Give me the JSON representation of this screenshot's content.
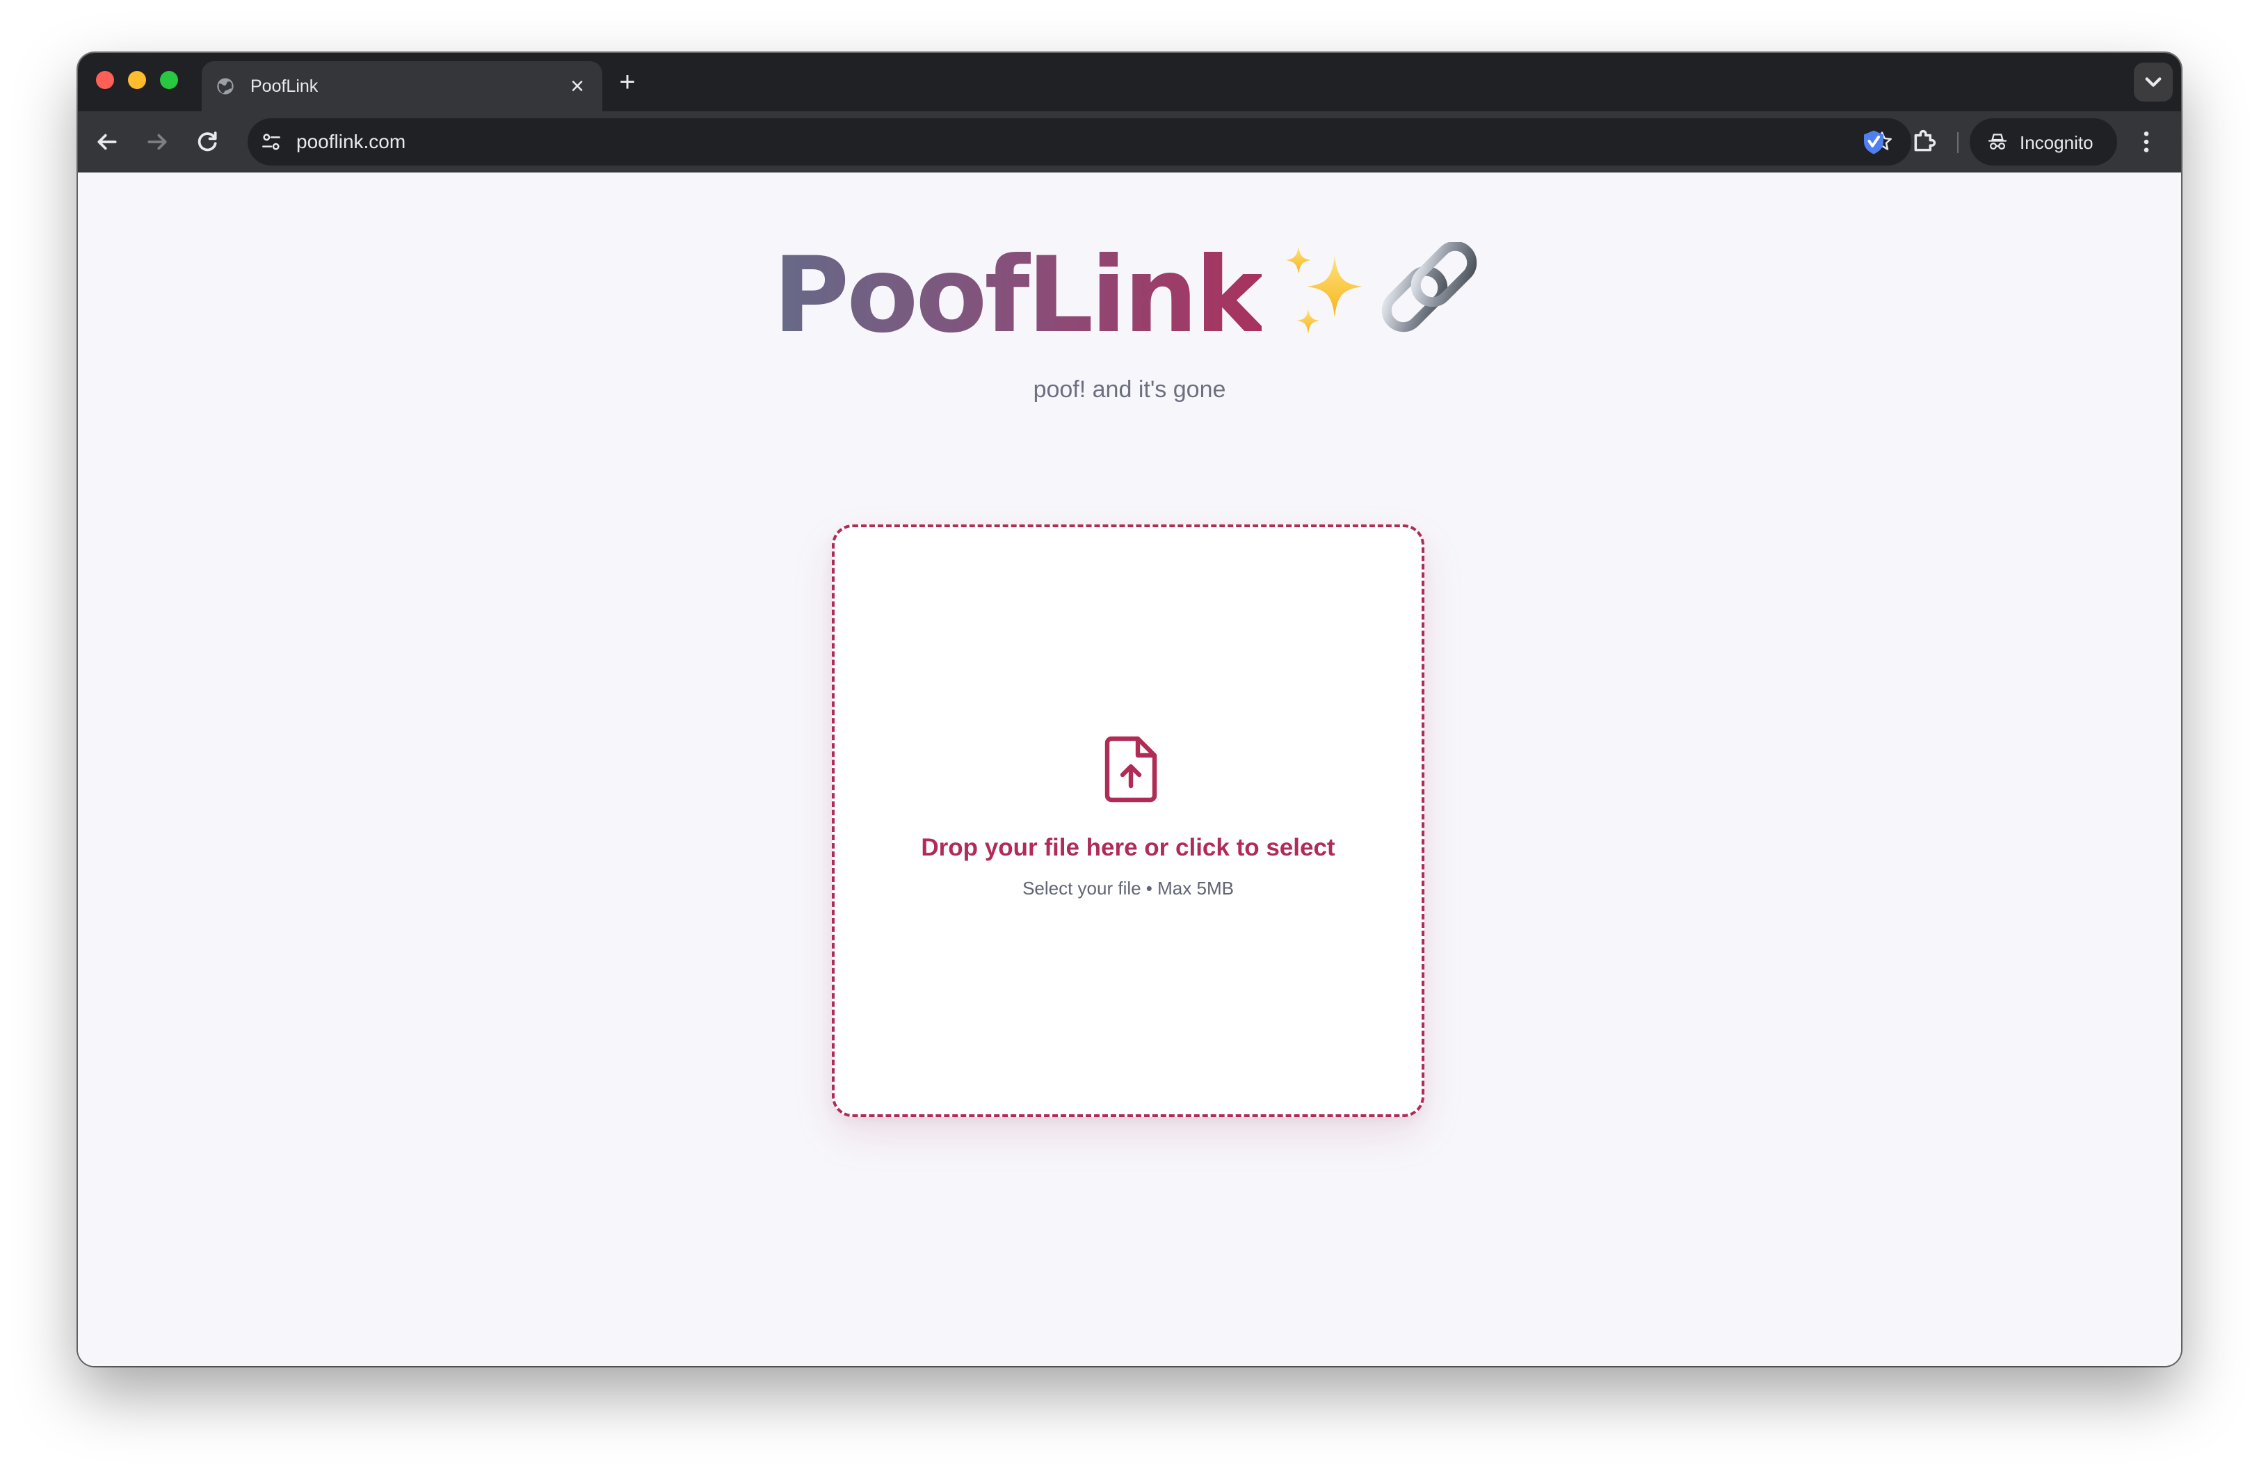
{
  "browser": {
    "tab": {
      "title": "PoofLink",
      "close_glyph": "×",
      "favicon": "globe-icon"
    },
    "new_tab_glyph": "+",
    "address_bar": {
      "url": "pooflink.com"
    },
    "profile_label": "Incognito",
    "icons": [
      "back-arrow-icon",
      "forward-arrow-icon",
      "reload-icon",
      "site-settings-icon",
      "star-icon",
      "extension-icon",
      "puzzle-icon",
      "incognito-icon",
      "kebab-menu-icon",
      "tab-search-icon"
    ]
  },
  "app": {
    "title": "PoofLink",
    "title_emoji": "sparkles-link-icon",
    "tagline": "poof! and it's gone"
  },
  "dropzone": {
    "title": "Drop your file here or click to select",
    "subtitle": "Select your file • Max 5MB",
    "icon": "file-upload-icon"
  },
  "colors": {
    "accent": "#b02b56",
    "title_gradient_start": "#666a88",
    "title_gradient_end": "#a8325e",
    "page_background": "#f7f7fb",
    "browser_dark": "#202124",
    "browser_toolbar": "#35363a"
  }
}
